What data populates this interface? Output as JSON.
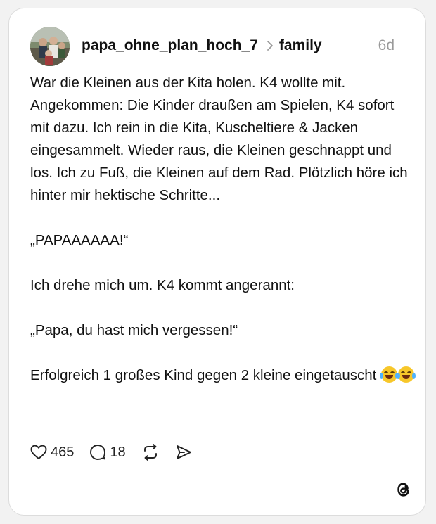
{
  "post": {
    "username": "papa_ohne_plan_hoch_7",
    "topic": "family",
    "time": "6d",
    "paragraphs": [
      "War die Kleinen aus der Kita holen. K4 wollte mit. Angekommen: Die Kinder draußen am Spielen, K4 sofort mit dazu. Ich rein in die Kita, Kuscheltiere & Jacken eingesammelt. Wieder raus, die Kleinen geschnappt und los. Ich zu Fuß, die Kleinen auf dem Rad. Plötzlich höre ich hinter mir hektische Schritte...",
      "„PAPAAAAAA!“",
      "Ich drehe mich um. K4 kommt angerannt:",
      "„Papa, du hast mich vergessen!“",
      "Erfolgreich 1 großes Kind gegen 2 kleine eingetauscht"
    ],
    "emoji": [
      "face-with-tears-of-joy",
      "face-with-tears-of-joy"
    ]
  },
  "actions": {
    "likes": "465",
    "replies": "18"
  },
  "icons": {
    "like": "heart-icon",
    "reply": "comment-icon",
    "repost": "repost-icon",
    "share": "send-icon",
    "brand": "threads-logo-icon"
  },
  "colors": {
    "text": "#111111",
    "muted": "#9a9a9a",
    "card": "#ffffff",
    "background": "#f2f2f2"
  }
}
